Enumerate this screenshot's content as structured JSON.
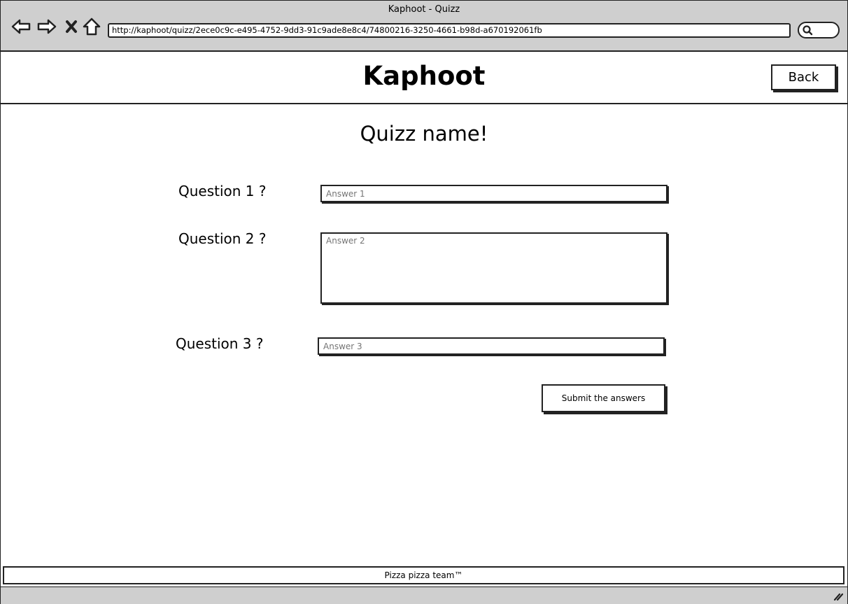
{
  "window": {
    "title": "Kaphoot - Quizz",
    "url": "http://kaphoot/quizz/2ece0c9c-e495-4752-9dd3-91c9ade8e8c4/74800216-3250-4661-b98d-a670192061fb"
  },
  "nav": {
    "icons": [
      "back-arrow-icon",
      "forward-arrow-icon",
      "close-icon",
      "home-icon",
      "search-icon"
    ]
  },
  "header": {
    "brand": "Kaphoot",
    "back_label": "Back"
  },
  "quiz": {
    "title": "Quizz name!",
    "questions": [
      {
        "label": "Question 1 ?",
        "answer_placeholder": "Answer 1"
      },
      {
        "label": "Question 2 ?",
        "answer_placeholder": "Answer 2"
      },
      {
        "label": "Question 3 ?",
        "answer_placeholder": "Answer 3"
      }
    ],
    "submit_label": "Submit the answers"
  },
  "footer": {
    "text": "Pizza pizza team™"
  },
  "colors": {
    "chrome": "#cfcfcf",
    "stroke": "#222222",
    "background": "#ffffff"
  }
}
